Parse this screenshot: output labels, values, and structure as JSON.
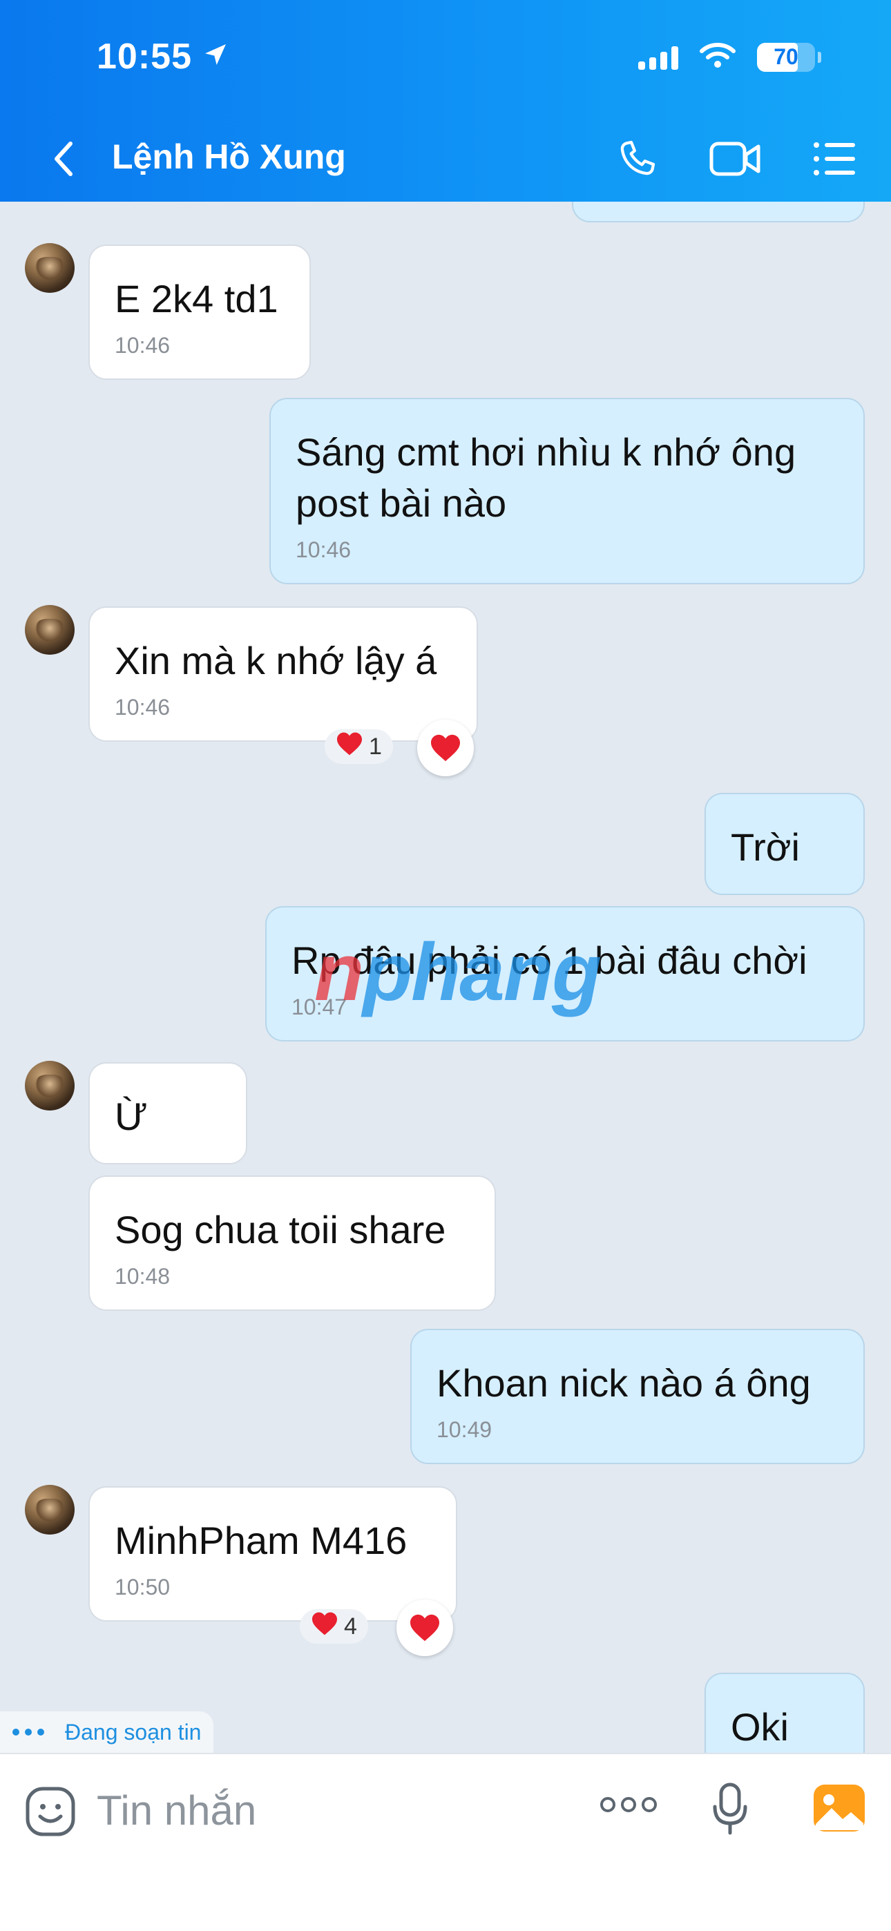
{
  "status_bar": {
    "time": "10:55",
    "battery": "70",
    "battery_level": 0.7
  },
  "header": {
    "title": "Lệnh Hồ Xung"
  },
  "messages": [
    {
      "text": "E 2k4 td1",
      "time": "10:46"
    },
    {
      "text": "Sáng cmt hơi nhìu k nhớ ông\npost bài nào",
      "time": "10:46"
    },
    {
      "text": "Xin mà k nhớ lậy á",
      "time": "10:46",
      "reaction_count": "1"
    },
    {
      "text": "Trời"
    },
    {
      "text": "Rp đâu phải có 1 bài đâu chời",
      "time": "10:47"
    },
    {
      "text": "Ừ"
    },
    {
      "text": "Sog chua toii share",
      "time": "10:48"
    },
    {
      "text": "Khoan nick nào á ông",
      "time": "10:49"
    },
    {
      "text": "MinhPham M416",
      "time": "10:50",
      "reaction_count": "4"
    },
    {
      "text": "Oki"
    }
  ],
  "typing_indicator": "Đang soạn tin",
  "watermark": {
    "part1": "n",
    "part2": "phang"
  },
  "composer": {
    "placeholder": "Tin nhắn"
  },
  "colors": {
    "header": "#0a78ee",
    "outgoing": "#d5efff",
    "incoming": "#ffffff",
    "background": "#e2e9f1",
    "heart": "#e8202f"
  }
}
